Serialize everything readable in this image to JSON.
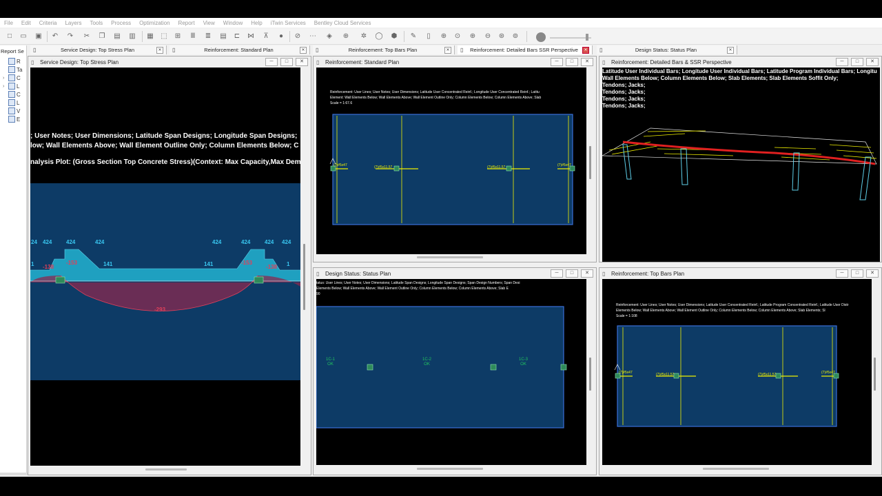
{
  "menu": [
    "File",
    "Edit",
    "Criteria",
    "Layers",
    "Tools",
    "Process",
    "Optimization",
    "Report",
    "View",
    "Window",
    "Help",
    "iTwin Services",
    "Bentley Cloud Services"
  ],
  "left_panel": {
    "header": "Report Se",
    "items": [
      "R",
      "Ta",
      "C",
      "L",
      "C",
      "L",
      "V",
      "E"
    ]
  },
  "tabs": [
    {
      "label": "Service Design: Top Stress Plan"
    },
    {
      "label": "Reinforcement: Standard Plan"
    },
    {
      "label": "Reinforcement: Top Bars Plan"
    },
    {
      "label": "Reinforcement: Detailed Bars  SSR Perspective",
      "active": true
    },
    {
      "label": "Design Status: Status Plan"
    }
  ],
  "windows": {
    "stress": {
      "title": "Service Design: Top Stress Plan",
      "line1": "; User Notes; User Dimensions; Latitude Span Designs; Longitude Span Designs;",
      "line2": "low; Wall Elements Above; Wall Element Outline Only; Column Elements Below; C",
      "line3": "nalysis Plot: (Gross Section Top Concrete Stress)(Context: Max Capacity,Max Dem",
      "values_top": [
        "24",
        "424",
        "424",
        "424",
        "424",
        "424",
        "424",
        "424"
      ],
      "values_mid": [
        "1",
        "141",
        "141",
        "1"
      ],
      "values_red": [
        "-138",
        "-153",
        "-153",
        "-138"
      ],
      "value_min": "-293"
    },
    "standard": {
      "title": "Reinforcement: Standard Plan",
      "line1": "Reinforcement: User Lines; User Notes; User Dimensions; Latitude User Concentrated Reinf.; Longitude User Concentrated Reinf.; Latitu",
      "line2": "Element: Wall Elements Below; Wall Elements Above; Wall Element Outline Only; Column Elements Below; Column Elements Above; Slab",
      "line3": "Scale = 1:67.6",
      "bar_left": "(7)#5x47",
      "bar_a": "(7)#5x11.57",
      "bar_b": "(7)#5x11.57",
      "bar_right": "(7)#5x47"
    },
    "perspective": {
      "title": "Reinforcement: Detailed Bars & SSR Perspective",
      "line1": "Latitude User Individual Bars; Longitude User Individual Bars; Latitude Program Individual Bars; Longitu",
      "line2": "Wall Elements Below; Column Elements Below; Slab Elements; Slab Elements Soffit Only;",
      "tendons": [
        "Tendons; Jacks;",
        "Tendons; Jacks;",
        "Tendons; Jacks;",
        "Tendons; Jacks;"
      ]
    },
    "status": {
      "title": "Design Status: Status Plan",
      "line1": "tatus: User Lines; User Notes; User Dimensions; Latitude Span Designs; Longitude Span Designs; Span Design Numbers; Span Desi",
      "line2": "Elements Below; Wall Elements Above; Wall Element Outline Only; Column Elements Below; Column Elements Above; Slab E",
      "line3": "90",
      "spans": [
        {
          "id": "1C-1",
          "status": "OK"
        },
        {
          "id": "1C-2",
          "status": "OK"
        },
        {
          "id": "1C-3",
          "status": "OK"
        }
      ]
    },
    "topbars": {
      "title": "Reinforcement: Top Bars Plan",
      "line1": "Reinforcement: User Lines; User Notes; User Dimensions; Latitude User Concentrated Reinf.; Latitude Program Concentrated Reinf.; Latitude User Distr",
      "line2": "Elements Below; Wall Elements Above; Wall Element Outline Only; Column Elements Below; Column Elements Above; Slab Elements; Sl",
      "line3": "Scale = 1:108",
      "bar_left": "(7)#5x47",
      "bar_a": "(7)#5x11.57",
      "bar_b": "(7)#5x11.57",
      "bar_right": "(7)#5x47"
    }
  },
  "colors": {
    "panel": "#0d3b66",
    "panel_border": "#3a6fd8",
    "rebar": "#f0f000",
    "stress_fill": "#1fa0c0",
    "tension": "#c0304a",
    "ok": "#22c55e"
  }
}
